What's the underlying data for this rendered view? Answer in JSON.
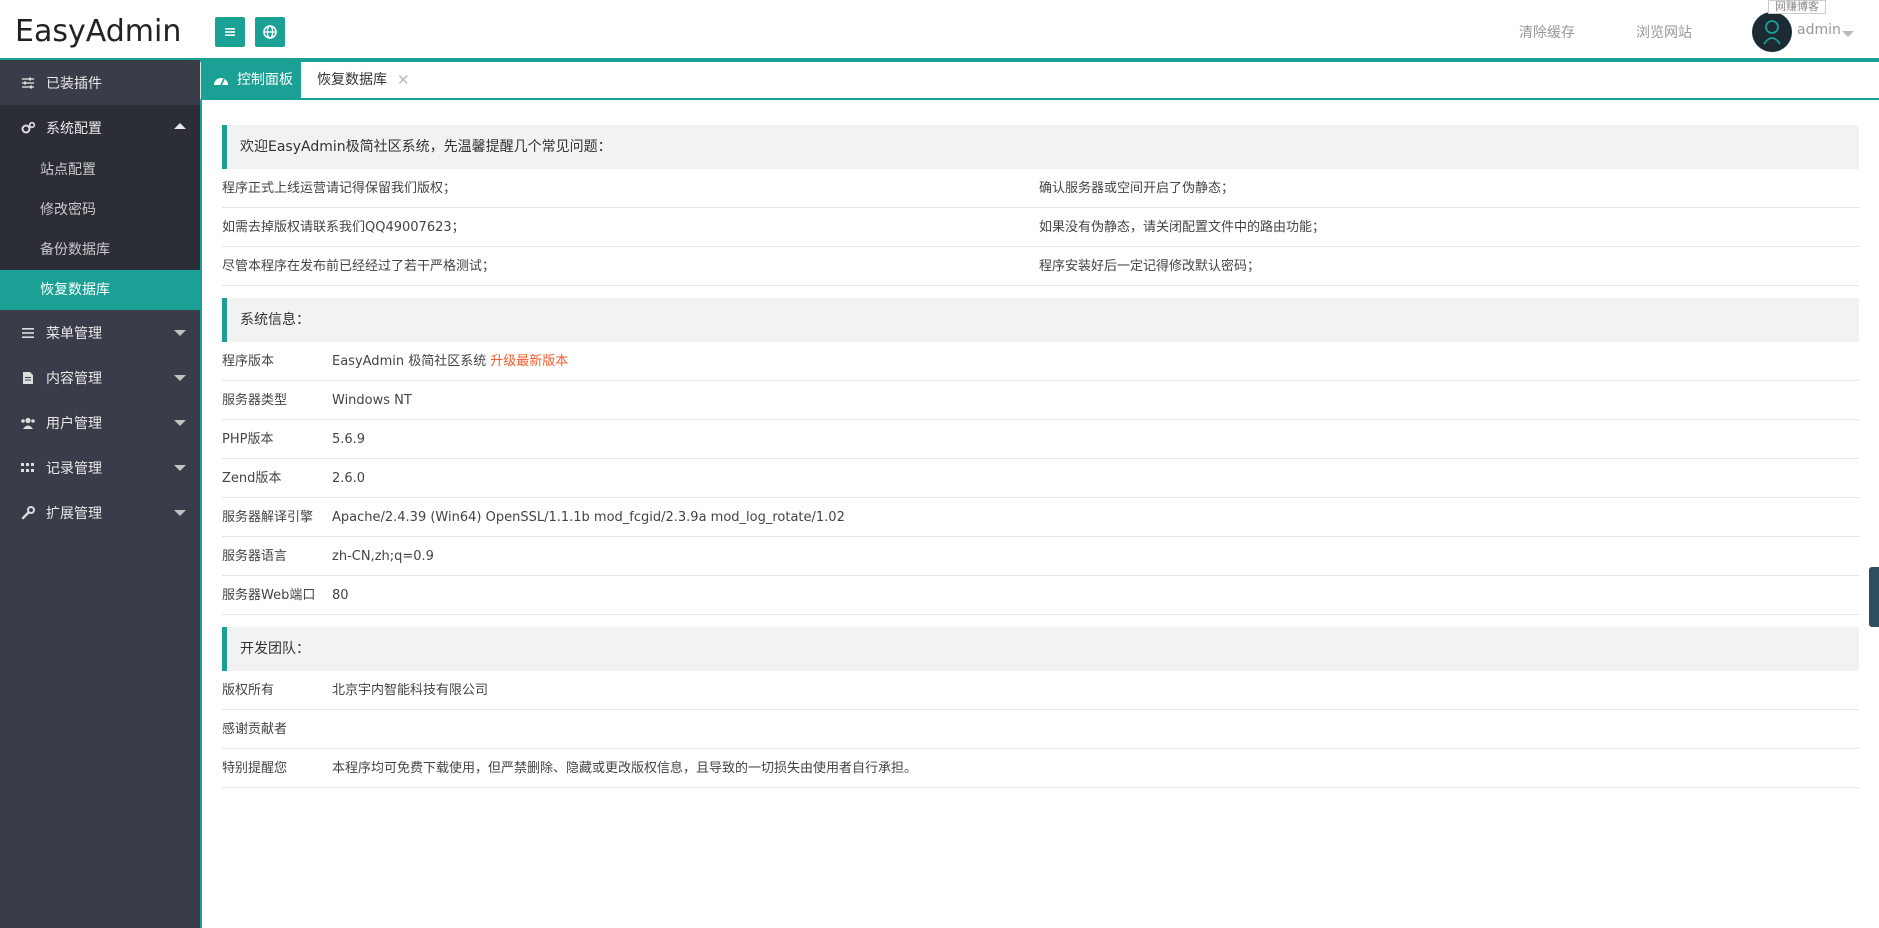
{
  "header": {
    "logo": "EasyAdmin",
    "clear_cache": "清除缓存",
    "browse_site": "浏览网站",
    "user_name": "admin",
    "tooltip": "网赚博客"
  },
  "sidebar": {
    "items": [
      {
        "label": "已装插件",
        "icon": "sliders-icon"
      },
      {
        "label": "系统配置",
        "icon": "gears-icon",
        "sub": [
          "站点配置",
          "修改密码",
          "备份数据库",
          "恢复数据库"
        ],
        "active_sub": "恢复数据库"
      },
      {
        "label": "菜单管理",
        "icon": "list-icon"
      },
      {
        "label": "内容管理",
        "icon": "file-icon"
      },
      {
        "label": "用户管理",
        "icon": "users-icon"
      },
      {
        "label": "记录管理",
        "icon": "grid-icon"
      },
      {
        "label": "扩展管理",
        "icon": "wrench-icon"
      }
    ]
  },
  "tabs": {
    "home": "控制面板",
    "current": "恢复数据库",
    "close": "✕"
  },
  "welcome": {
    "title": "欢迎EasyAdmin极简社区系统，先温馨提醒几个常见问题：",
    "rows": [
      [
        "程序正式上线运营请记得保留我们版权；",
        "确认服务器或空间开启了伪静态；"
      ],
      [
        "如需去掉版权请联系我们QQ49007623；",
        "如果没有伪静态，请关闭配置文件中的路由功能；"
      ],
      [
        "尽管本程序在发布前已经经过了若干严格测试；",
        "程序安装好后一定记得修改默认密码；"
      ]
    ]
  },
  "sysinfo": {
    "title": "系统信息：",
    "version_label": "程序版本",
    "version_value": "EasyAdmin 极简社区系统",
    "upgrade_link": "升级最新版本",
    "rows": [
      {
        "label": "服务器类型",
        "value": "Windows NT"
      },
      {
        "label": "PHP版本",
        "value": "5.6.9"
      },
      {
        "label": "Zend版本",
        "value": "2.6.0"
      },
      {
        "label": "服务器解译引擎",
        "value": "Apache/2.4.39 (Win64) OpenSSL/1.1.1b mod_fcgid/2.3.9a mod_log_rotate/1.02"
      },
      {
        "label": "服务器语言",
        "value": "zh-CN,zh;q=0.9"
      },
      {
        "label": "服务器Web端口",
        "value": "80"
      }
    ]
  },
  "team": {
    "title": "开发团队：",
    "rows": [
      {
        "label": "版权所有",
        "value": "北京宇内智能科技有限公司"
      },
      {
        "label": "感谢贡献者",
        "value": ""
      },
      {
        "label": "特别提醒您",
        "value": "本程序均可免费下载使用，但严禁删除、隐藏或更改版权信息，且导致的一切损失由使用者自行承担。"
      }
    ]
  },
  "colors": {
    "accent": "#1aa094",
    "sidebar": "#393d49",
    "link_orange": "#f45c2c"
  }
}
